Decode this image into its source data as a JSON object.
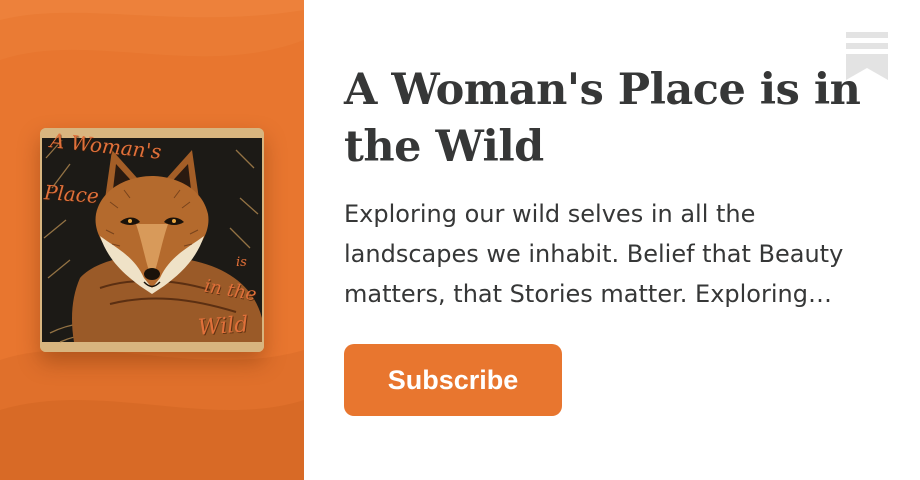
{
  "publication": {
    "title": "A Woman's Place is in the Wild",
    "description": "Exploring our wild selves in all the landscapes we inhabit. Belief that Beauty matters, that Stories matter. Exploring the stories of women in the wild.",
    "cover": {
      "title_lines": [
        "A Woman's",
        "Place",
        "is",
        "in the",
        "Wild"
      ],
      "icon": "fox-illustration"
    }
  },
  "actions": {
    "subscribe_label": "Subscribe"
  },
  "icons": {
    "logo": "substack-bookmark-icon"
  },
  "colors": {
    "accent": "#E8762F",
    "text": "#363737",
    "logo_gray": "#E3E3E3"
  }
}
